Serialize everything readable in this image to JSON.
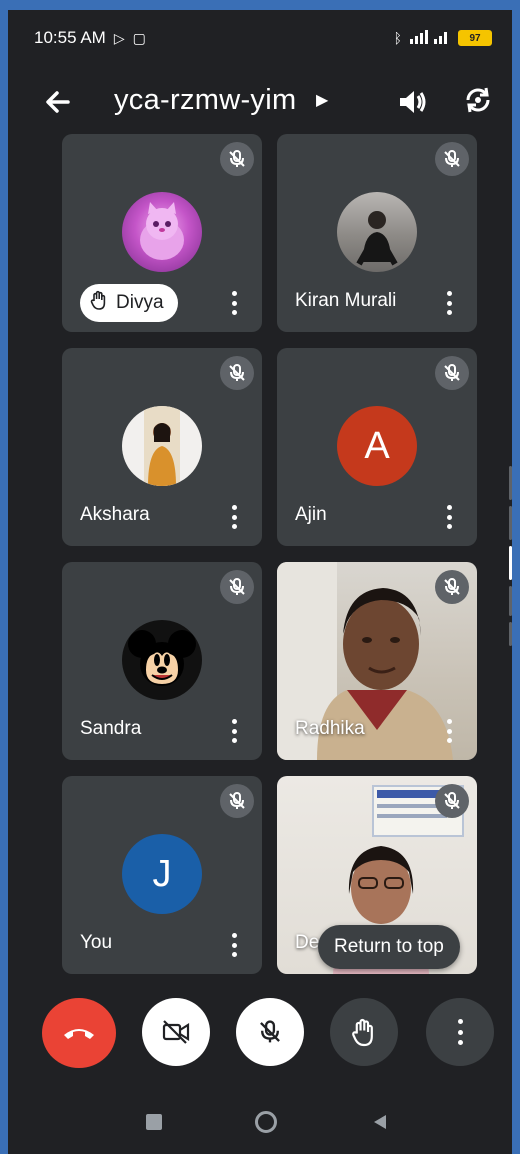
{
  "status_bar": {
    "time": "10:55 AM",
    "battery": "97"
  },
  "header": {
    "meeting_code": "yca-rzmw-yim"
  },
  "participants": [
    {
      "name": "Divya",
      "avatar": "kitten-photo",
      "hand_raised": true,
      "muted": true
    },
    {
      "name": "Kiran Murali",
      "avatar": "person-photo",
      "muted": true
    },
    {
      "name": "Akshara",
      "avatar": "person-photo",
      "muted": true
    },
    {
      "name": "Ajin",
      "avatar_letter": "A",
      "avatar_color": "#c5391c",
      "muted": true
    },
    {
      "name": "Sandra",
      "avatar": "mickey-mouse",
      "muted": true
    },
    {
      "name": "Radhika",
      "video": true,
      "muted": true
    },
    {
      "name": "You",
      "avatar_letter": "J",
      "avatar_color": "#1a5fa8",
      "muted": true
    },
    {
      "name": "Dee",
      "video": true,
      "muted": true
    }
  ],
  "return_to_top": "Return to top",
  "colors": {
    "end_call": "#ea4335",
    "background": "#202124",
    "tile": "#3c4043"
  }
}
